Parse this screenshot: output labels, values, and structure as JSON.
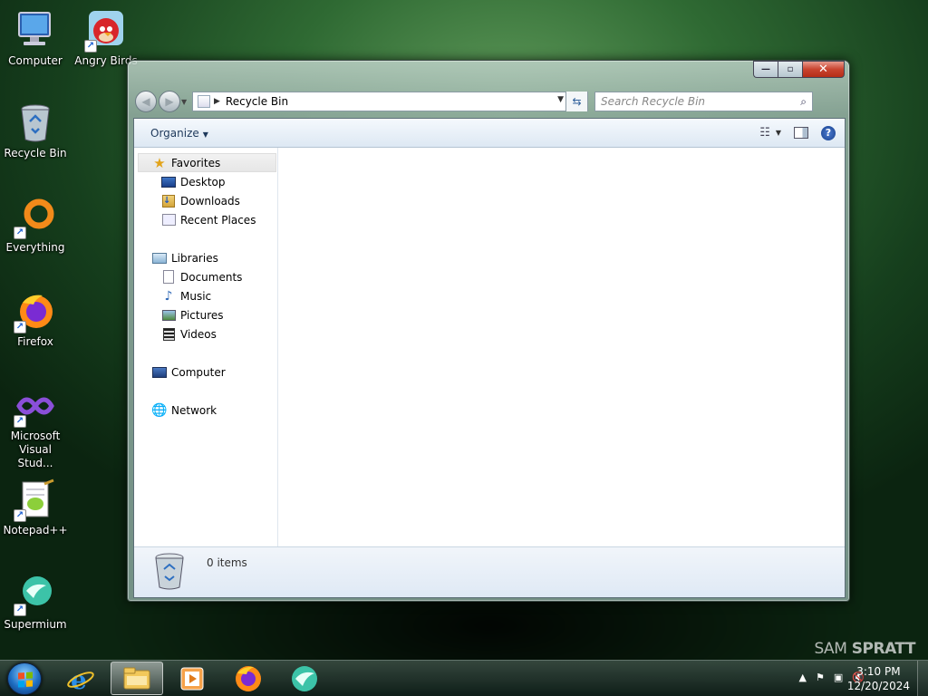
{
  "desktop": {
    "icons": [
      {
        "label": "Computer",
        "icon": "computer-icon",
        "shortcut": false
      },
      {
        "label": "Angry Birds",
        "icon": "angry-birds-icon",
        "shortcut": true
      },
      {
        "label": "Recycle Bin",
        "icon": "recycle-bin-icon",
        "shortcut": false
      },
      {
        "label": "Everything",
        "icon": "everything-icon",
        "shortcut": true
      },
      {
        "label": "Firefox",
        "icon": "firefox-icon",
        "shortcut": true
      },
      {
        "label": "Microsoft Visual Stud...",
        "icon": "visual-studio-icon",
        "shortcut": true
      },
      {
        "label": "Notepad++",
        "icon": "notepadpp-icon",
        "shortcut": true
      },
      {
        "label": "Supermium",
        "icon": "supermium-icon",
        "shortcut": true
      }
    ]
  },
  "window": {
    "address": {
      "location": "Recycle Bin"
    },
    "search": {
      "placeholder": "Search Recycle Bin"
    },
    "toolbar": {
      "organize_label": "Organize"
    },
    "navpane": {
      "favorites": "Favorites",
      "desktop": "Desktop",
      "downloads": "Downloads",
      "recent_places": "Recent Places",
      "libraries": "Libraries",
      "documents": "Documents",
      "music": "Music",
      "pictures": "Pictures",
      "videos": "Videos",
      "computer": "Computer",
      "network": "Network"
    },
    "details": {
      "item_count": "0 items"
    }
  },
  "taskbar": {
    "apps": [
      "internet-explorer-icon",
      "windows-explorer-icon",
      "media-player-icon",
      "firefox-icon",
      "supermium-icon"
    ],
    "active_app": "windows-explorer-icon",
    "clock": {
      "time": "3:10 PM",
      "date": "12/20/2024"
    }
  },
  "watermark": {
    "left": "SAM",
    "right": "SPRATT"
  },
  "colors": {
    "accent": "#1e395b",
    "close_button": "#c9442f"
  }
}
